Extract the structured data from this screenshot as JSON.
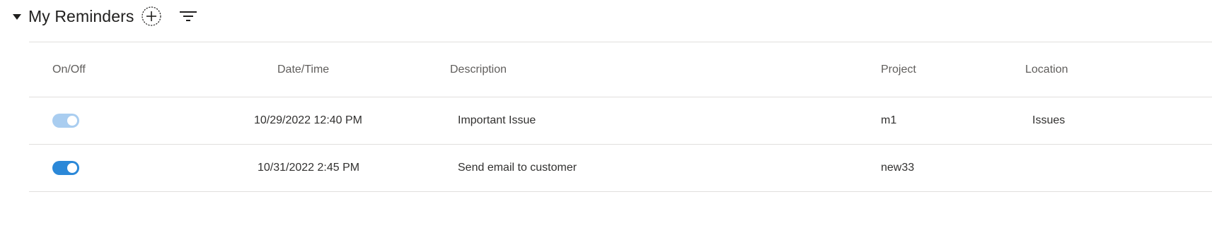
{
  "section": {
    "title": "My Reminders",
    "collapse_icon": "caret-down-icon",
    "add_icon": "add-circle-icon",
    "filter_icon": "filter-icon"
  },
  "table": {
    "columns": [
      "On/Off",
      "Date/Time",
      "Description",
      "Project",
      "Location"
    ],
    "rows": [
      {
        "enabled": true,
        "toggle_color": "#a9cdf0",
        "datetime": "10/29/2022 12:40 PM",
        "description": "Important Issue",
        "project": "m1",
        "location": "Issues"
      },
      {
        "enabled": true,
        "toggle_color": "#2b88d8",
        "datetime": "10/31/2022 2:45 PM",
        "description": "Send email to customer",
        "project": "new33",
        "location": ""
      }
    ]
  },
  "colors": {
    "divider": "#e1dfdd",
    "header_text": "#605e5c",
    "body_text": "#323130",
    "accent": "#2b88d8"
  }
}
